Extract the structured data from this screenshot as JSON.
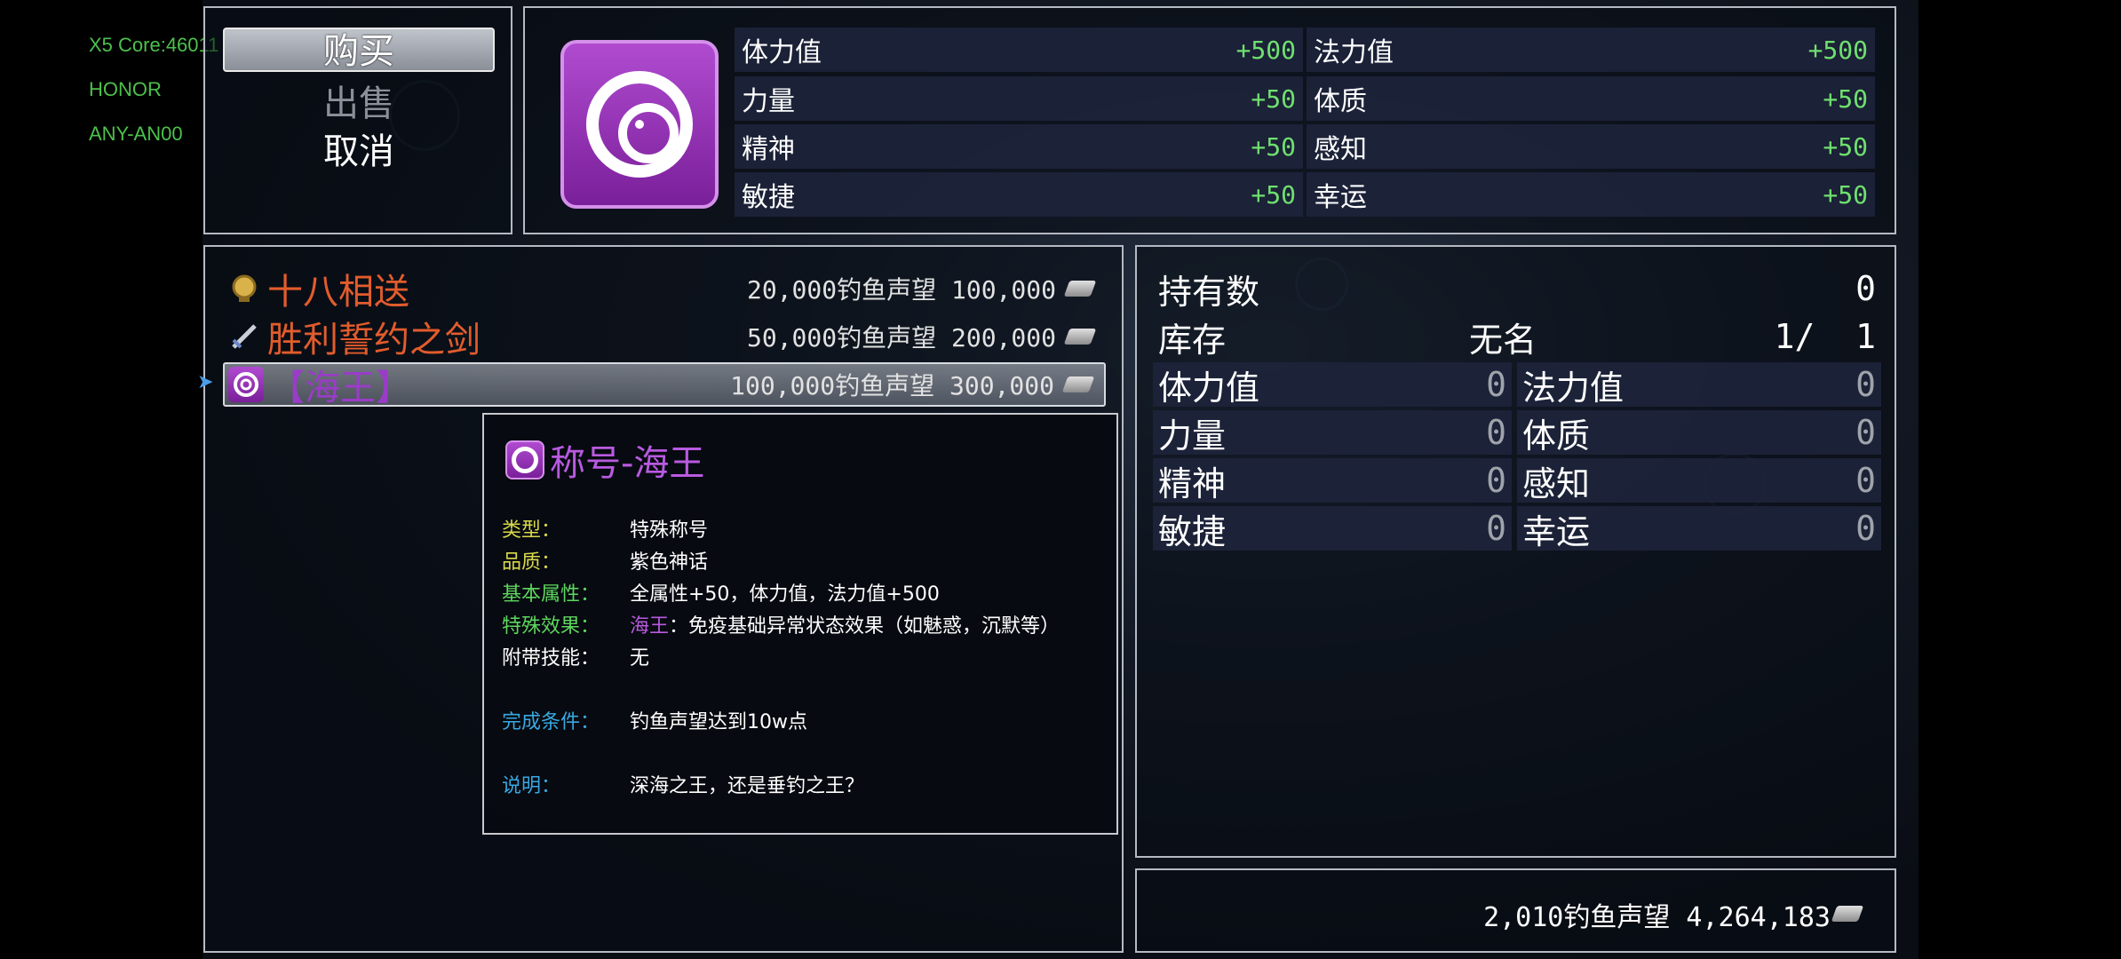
{
  "device_info": [
    "X5 Core:46011",
    "HONOR",
    "ANY-AN00"
  ],
  "commands": [
    {
      "label": "购买",
      "state": "selected"
    },
    {
      "label": "出售",
      "state": "disabled"
    },
    {
      "label": "取消",
      "state": "normal"
    }
  ],
  "status": {
    "icon": "target-icon",
    "stats": [
      {
        "label": "体力值",
        "value": "+500"
      },
      {
        "label": "法力值",
        "value": "+500"
      },
      {
        "label": "力量",
        "value": "+50"
      },
      {
        "label": "体质",
        "value": "+50"
      },
      {
        "label": "精神",
        "value": "+50"
      },
      {
        "label": "感知",
        "value": "+50"
      },
      {
        "label": "敏捷",
        "value": "+50"
      },
      {
        "label": "幸运",
        "value": "+50"
      }
    ]
  },
  "shop_items": [
    {
      "icon": "medal-icon",
      "name": "十八相送",
      "price": "20,000钓鱼声望 100,000"
    },
    {
      "icon": "sword-icon",
      "name": "胜利誓约之剑",
      "price": "50,000钓鱼声望 200,000"
    },
    {
      "icon": "target-icon",
      "name": "【海王】",
      "price": "100,000钓鱼声望 300,000",
      "selected": true
    }
  ],
  "tooltip": {
    "title": "称号-海王",
    "rows": [
      {
        "key": "类型：",
        "value": "特殊称号"
      },
      {
        "key": "品质：",
        "value": "紫色神话"
      },
      {
        "key": "基本属性：",
        "value": "全属性+50，体力值，法力值+500"
      },
      {
        "key": "特殊效果：",
        "value_highlight": "海王",
        "value": "：免疫基础异常状态效果（如魅惑，沉默等）"
      },
      {
        "key": "附带技能：",
        "value": "无"
      },
      {
        "key": "完成条件：",
        "value": "钓鱼声望达到10w点"
      },
      {
        "key": "说明：",
        "value": "深海之王，还是垂钓之王？"
      }
    ]
  },
  "detail": {
    "owned_label": "持有数",
    "owned_value": "0",
    "stock_label": "库存",
    "stock_name": "无名",
    "stock_value": "1/  1",
    "stats": [
      {
        "label": "体力值",
        "value": "0"
      },
      {
        "label": "法力值",
        "value": "0"
      },
      {
        "label": "力量",
        "value": "0"
      },
      {
        "label": "体质",
        "value": "0"
      },
      {
        "label": "精神",
        "value": "0"
      },
      {
        "label": "感知",
        "value": "0"
      },
      {
        "label": "敏捷",
        "value": "0"
      },
      {
        "label": "幸运",
        "value": "0"
      }
    ]
  },
  "gold": "2,010钓鱼声望 4,264,183",
  "colors": {
    "stat_bonus": "#6fe06f",
    "item_name": "#e25c2c",
    "mythic_purple": "#b95ae0"
  }
}
